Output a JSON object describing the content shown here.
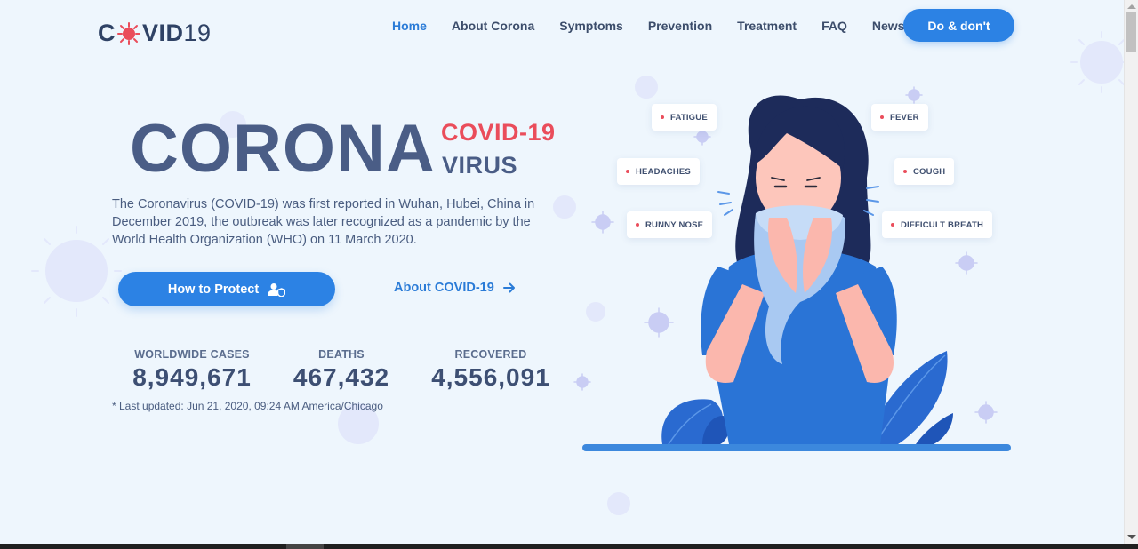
{
  "header": {
    "logo": {
      "part1": "C",
      "part2": "VID",
      "part3": "19"
    },
    "nav": [
      {
        "label": "Home",
        "active": true
      },
      {
        "label": "About Corona",
        "active": false
      },
      {
        "label": "Symptoms",
        "active": false
      },
      {
        "label": "Prevention",
        "active": false
      },
      {
        "label": "Treatment",
        "active": false
      },
      {
        "label": "FAQ",
        "active": false
      },
      {
        "label": "News",
        "active": false
      }
    ],
    "cta_label": "Do & don't"
  },
  "hero": {
    "title_big": "CORONA",
    "title_covid": "COVID-19",
    "title_virus": "VIRUS",
    "description": "The Coronavirus (COVID-19) was first reported in Wuhan, Hubei, China in December 2019, the outbreak was later recognized as a pandemic by the World Health Organization (WHO) on 11 March 2020.",
    "protect_button": "How to Protect",
    "about_link": "About COVID-19"
  },
  "stats": [
    {
      "label": "WORLDWIDE CASES",
      "value": "8,949,671"
    },
    {
      "label": "DEATHS",
      "value": "467,432"
    },
    {
      "label": "RECOVERED",
      "value": "4,556,091"
    }
  ],
  "last_updated": "* Last updated: Jun 21, 2020, 09:24 AM America/Chicago",
  "symptoms": {
    "fatigue": "FATIGUE",
    "fever": "FEVER",
    "headaches": "HEADACHES",
    "cough": "COUGH",
    "runny_nose": "RUNNY NOSE",
    "difficult_breath": "DIFFICULT BREATH"
  },
  "colors": {
    "primary": "#2c82e4",
    "accent_red": "#ea4d5b",
    "heading": "#4a5d86",
    "background": "#eef6fd"
  }
}
